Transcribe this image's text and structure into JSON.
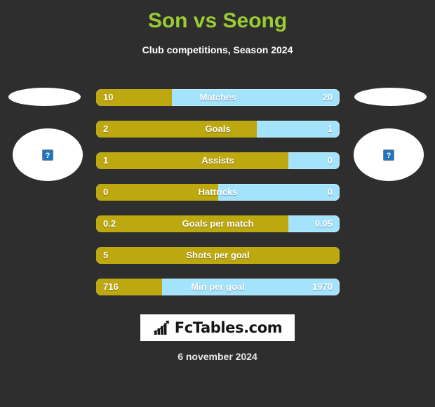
{
  "header": {
    "title": "Son vs Seong",
    "subtitle": "Club competitions, Season 2024",
    "title_color": "#9acd32"
  },
  "players": {
    "left": {
      "photo_alt_icon": "broken-image-icon",
      "alt_glyph": "?"
    },
    "right": {
      "photo_alt_icon": "broken-image-icon",
      "alt_glyph": "?"
    }
  },
  "colors": {
    "background": "#2e2e2e",
    "home_bar": "#bda80f",
    "away_bar": "#a3e4fc",
    "title": "#9acd32",
    "text": "#ffffff"
  },
  "chart_data": {
    "type": "bar",
    "title": "Son vs Seong",
    "subtitle": "Club competitions, Season 2024",
    "orientation": "horizontal-diverging",
    "series": [
      {
        "name": "Son",
        "color": "#bda80f",
        "values": [
          "10",
          "2",
          "1",
          "0",
          "0.2",
          "5",
          "716"
        ]
      },
      {
        "name": "Seong",
        "color": "#a3e4fc",
        "values": [
          "20",
          "1",
          "0",
          "0",
          "0.05",
          "",
          "1970"
        ]
      }
    ],
    "categories": [
      "Matches",
      "Goals",
      "Assists",
      "Hattricks",
      "Goals per match",
      "Shots per goal",
      "Min per goal"
    ],
    "rows": [
      {
        "label": "Matches",
        "left_value": "10",
        "right_value": "20",
        "fill_percent": 31,
        "full": false
      },
      {
        "label": "Goals",
        "left_value": "2",
        "right_value": "1",
        "fill_percent": 66,
        "full": false
      },
      {
        "label": "Assists",
        "left_value": "1",
        "right_value": "0",
        "fill_percent": 79,
        "full": false
      },
      {
        "label": "Hattricks",
        "left_value": "0",
        "right_value": "0",
        "fill_percent": 50,
        "full": false
      },
      {
        "label": "Goals per match",
        "left_value": "0.2",
        "right_value": "0.05",
        "fill_percent": 79,
        "full": false
      },
      {
        "label": "Shots per goal",
        "left_value": "5",
        "right_value": "",
        "fill_percent": 100,
        "full": true
      },
      {
        "label": "Min per goal",
        "left_value": "716",
        "right_value": "1970",
        "fill_percent": 27,
        "full": false
      }
    ]
  },
  "footer": {
    "logo_icon": "bar-chart-growth-icon",
    "logo_text": "FcTables.com",
    "date": "6 november 2024"
  }
}
